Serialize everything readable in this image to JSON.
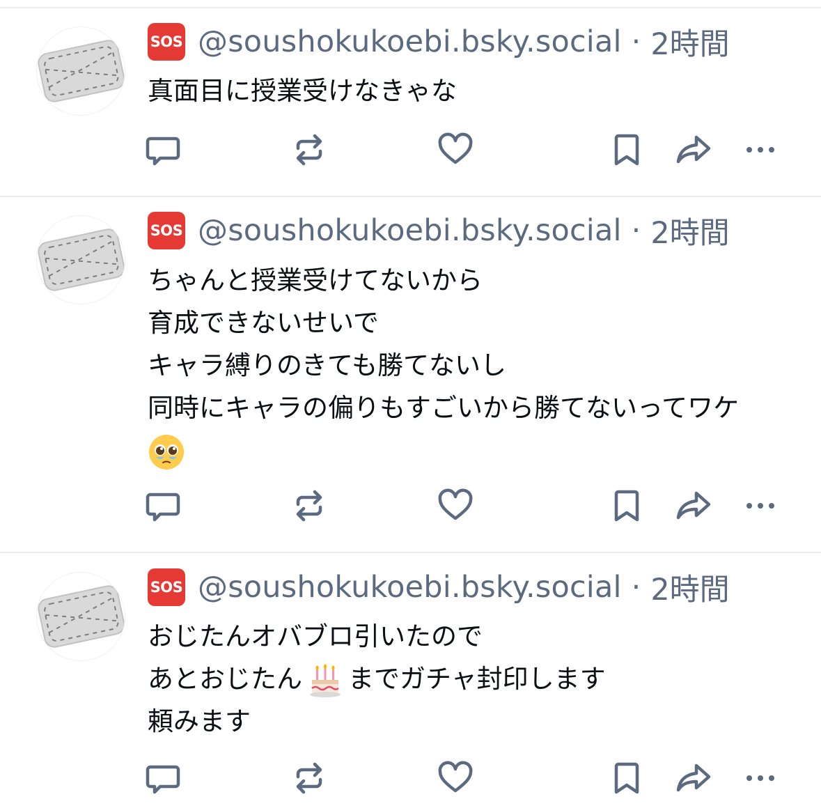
{
  "posts": [
    {
      "badge": "SOS",
      "handle": "@soushokukoebi.bsky.social",
      "separator": "·",
      "time": "2時間",
      "lines": [
        "真面目に授業受けなきゃな"
      ]
    },
    {
      "badge": "SOS",
      "handle": "@soushokukoebi.bsky.social",
      "separator": "·",
      "time": "2時間",
      "lines": [
        "ちゃんと授業受けてないから",
        "育成できないせいで",
        "キャラ縛りのきても勝てないし",
        "同時にキャラの偏りもすごいから勝てないってワケ"
      ],
      "emoji_line": "pleading-face-emoji"
    },
    {
      "badge": "SOS",
      "handle": "@soushokukoebi.bsky.social",
      "separator": "·",
      "time": "2時間",
      "lines_a": [
        "おじたんオバブロ引いたので"
      ],
      "line_with_emoji_pre": "あとおじたん",
      "line_with_emoji_post": "までガチャ封印します",
      "lines_b": [
        "頼みます"
      ]
    }
  ],
  "icons": {
    "reply": "reply-icon",
    "repost": "repost-icon",
    "like": "like-heart-icon",
    "bookmark": "bookmark-icon",
    "share": "share-icon",
    "more": "more-options-icon"
  },
  "colors": {
    "handle": "#5c6a7f",
    "icon": "#5c6a7f",
    "sos": "#e53935",
    "divider": "#e9ebef"
  }
}
